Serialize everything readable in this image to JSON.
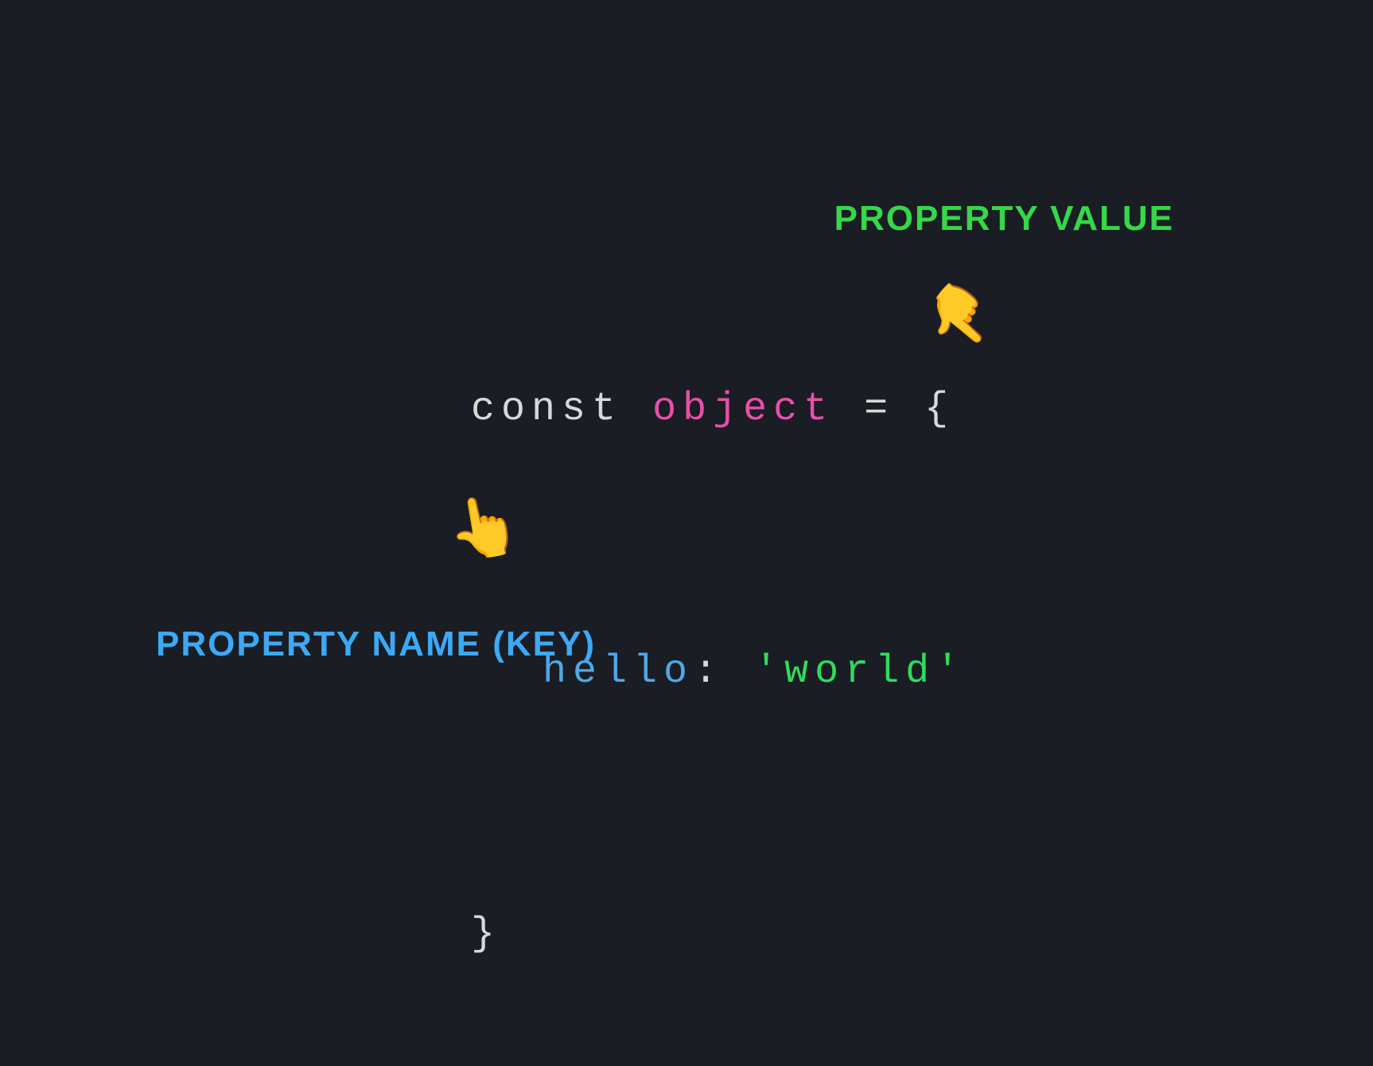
{
  "labels": {
    "property_value": "PROPERTY VALUE",
    "property_name": "PROPERTY NAME (KEY)"
  },
  "code": {
    "keyword": "const",
    "identifier": "object",
    "equals": " = ",
    "brace_open": "{",
    "brace_close": "}",
    "key": "hello",
    "colon": ":",
    "string": "'world'"
  },
  "icons": {
    "pointer_down_left": "👆",
    "pointer_up": "👆"
  },
  "colors": {
    "background": "#1a1d24",
    "green_label": "#35d848",
    "blue_label": "#3da9f5",
    "keyword": "#d8d8d8",
    "identifier": "#e84fab",
    "key": "#4fa8e8",
    "string": "#2fdc5f"
  }
}
